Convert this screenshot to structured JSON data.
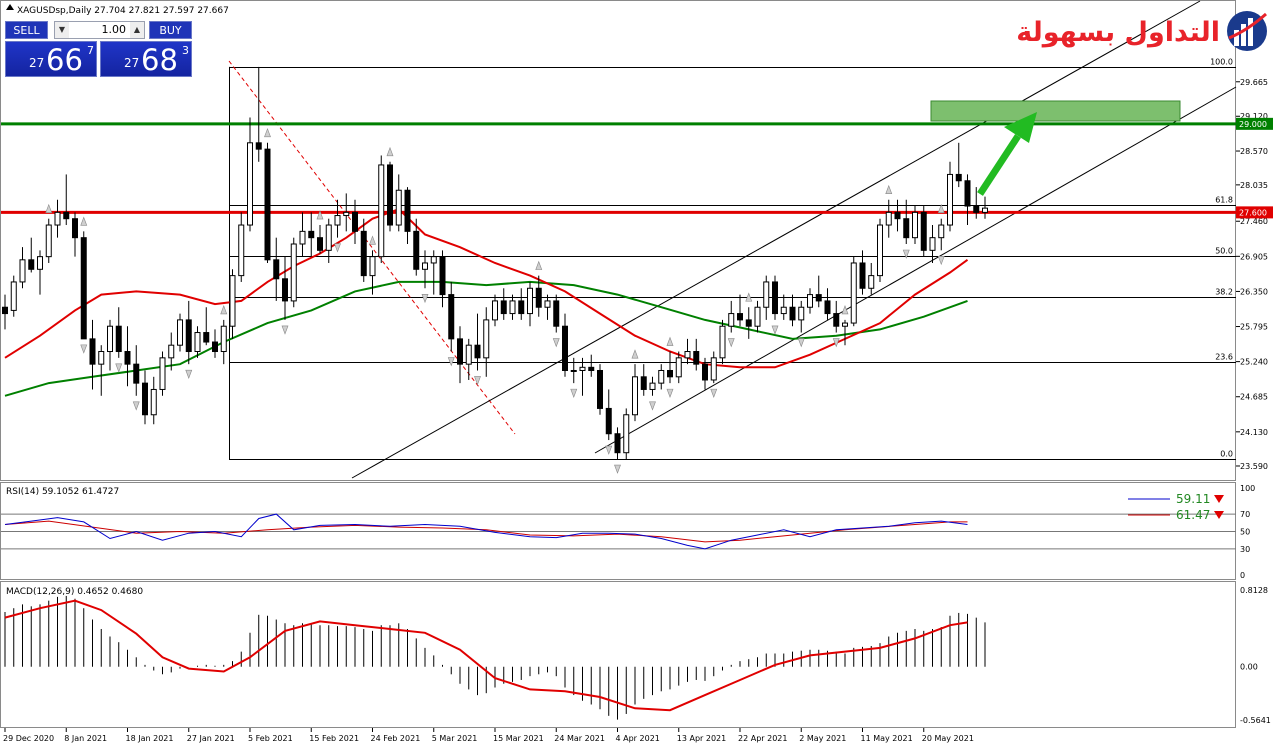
{
  "header": {
    "symbol_info": "XAGUSDsp,Daily  27.704 27.821 27.597 27.667"
  },
  "trade_panel": {
    "sell_label": "SELL",
    "buy_label": "BUY",
    "lot_value": "1.00",
    "sell_prefix": "27",
    "sell_big": "66",
    "sell_sup": "7",
    "buy_prefix": "27",
    "buy_big": "68",
    "buy_sup": "3"
  },
  "logo": {
    "text": "التداول بسهولة"
  },
  "main_axis": {
    "ticks": [
      "29.665",
      "29.120",
      "28.570",
      "28.035",
      "27.460",
      "26.905",
      "26.350",
      "25.795",
      "25.240",
      "24.685",
      "24.130",
      "23.590"
    ],
    "price_labels": [
      {
        "text": "29.000",
        "price": 29.0,
        "color": "#008000"
      },
      {
        "text": "27.600",
        "price": 27.6,
        "color": "#e00000"
      }
    ]
  },
  "fibonacci": {
    "levels": [
      {
        "label": "100.0",
        "price": 29.9
      },
      {
        "label": "61.8",
        "price": 27.72
      },
      {
        "label": "50.0",
        "price": 26.91
      },
      {
        "label": "38.2",
        "price": 26.26
      },
      {
        "label": "23.6",
        "price": 25.24
      },
      {
        "label": "0.0",
        "price": 23.7
      }
    ]
  },
  "horizontal_lines": [
    {
      "name": "resistance",
      "price": 29.0,
      "color": "#008000"
    },
    {
      "name": "support",
      "price": 27.6,
      "color": "#e00000"
    }
  ],
  "colors": {
    "bull_candle": "#ffffff",
    "bear_candle": "#000000",
    "ma_fast": "#e00000",
    "ma_slow": "#008000",
    "rsi_main": "#0000cc",
    "rsi_signal": "#cc0000",
    "macd_signal": "#e00000",
    "target_box": "#7dbf6e",
    "arrow": "#22bb22"
  },
  "rsi_panel": {
    "label": "RSI(14) 59.1052 61.4727",
    "ticks": [
      "100",
      "70",
      "50",
      "30",
      "0"
    ],
    "legend": [
      {
        "value": "59.11",
        "color": "#0000cc"
      },
      {
        "value": "61.47",
        "color": "#cc0000"
      }
    ]
  },
  "macd_panel": {
    "label": "MACD(12,26,9) 0.4652 0.4680",
    "ticks": [
      "0.8128",
      "0.00",
      "-0.5641"
    ]
  },
  "time_axis": {
    "labels": [
      "29 Dec 2020",
      "8 Jan 2021",
      "18 Jan 2021",
      "27 Jan 2021",
      "5 Feb 2021",
      "15 Feb 2021",
      "24 Feb 2021",
      "5 Mar 2021",
      "15 Mar 2021",
      "24 Mar 2021",
      "4 Apr 2021",
      "13 Apr 2021",
      "22 Apr 2021",
      "2 May 2021",
      "11 May 2021",
      "20 May 2021"
    ]
  },
  "chart_data": {
    "type": "candlestick",
    "symbol": "XAGUSDsp",
    "timeframe": "Daily",
    "ylim": [
      23.4,
      30.8
    ],
    "ohlc": [
      [
        26.1,
        26.3,
        25.75,
        26.0
      ],
      [
        26.05,
        26.6,
        25.95,
        26.5
      ],
      [
        26.5,
        27.05,
        26.4,
        26.85
      ],
      [
        26.85,
        27.2,
        26.65,
        26.7
      ],
      [
        26.7,
        27.0,
        26.3,
        26.9
      ],
      [
        26.9,
        27.5,
        26.8,
        27.4
      ],
      [
        27.4,
        27.8,
        27.2,
        27.6
      ],
      [
        27.6,
        28.2,
        27.4,
        27.5
      ],
      [
        27.5,
        27.6,
        26.9,
        27.2
      ],
      [
        27.2,
        27.3,
        25.6,
        25.6
      ],
      [
        25.6,
        25.9,
        24.8,
        25.2
      ],
      [
        25.2,
        25.5,
        24.7,
        25.4
      ],
      [
        25.4,
        25.9,
        25.1,
        25.8
      ],
      [
        25.8,
        26.1,
        25.3,
        25.4
      ],
      [
        25.4,
        25.8,
        24.85,
        25.2
      ],
      [
        25.2,
        25.5,
        24.7,
        24.9
      ],
      [
        24.9,
        25.1,
        24.25,
        24.4
      ],
      [
        24.4,
        25.0,
        24.25,
        24.8
      ],
      [
        24.8,
        25.4,
        24.7,
        25.3
      ],
      [
        25.3,
        25.7,
        25.1,
        25.5
      ],
      [
        25.5,
        26.0,
        25.4,
        25.9
      ],
      [
        25.9,
        26.2,
        25.2,
        25.4
      ],
      [
        25.4,
        25.8,
        25.3,
        25.7
      ],
      [
        25.7,
        26.1,
        25.5,
        25.55
      ],
      [
        25.55,
        25.75,
        25.3,
        25.4
      ],
      [
        25.4,
        25.9,
        25.2,
        25.8
      ],
      [
        25.8,
        26.7,
        25.6,
        26.6
      ],
      [
        26.6,
        27.6,
        26.5,
        27.4
      ],
      [
        27.4,
        29.1,
        27.3,
        28.7
      ],
      [
        28.7,
        29.9,
        28.4,
        28.6
      ],
      [
        28.6,
        28.7,
        26.8,
        26.85
      ],
      [
        26.85,
        27.2,
        26.2,
        26.55
      ],
      [
        26.55,
        26.9,
        25.9,
        26.2
      ],
      [
        26.2,
        27.2,
        26.1,
        27.1
      ],
      [
        27.1,
        27.6,
        26.9,
        27.3
      ],
      [
        27.3,
        27.6,
        26.9,
        27.2
      ],
      [
        27.2,
        27.4,
        26.95,
        27.0
      ],
      [
        27.0,
        27.5,
        26.8,
        27.4
      ],
      [
        27.4,
        27.8,
        27.2,
        27.55
      ],
      [
        27.55,
        27.9,
        27.3,
        27.6
      ],
      [
        27.6,
        27.8,
        27.1,
        27.3
      ],
      [
        27.3,
        27.5,
        26.5,
        26.6
      ],
      [
        26.6,
        27.0,
        26.3,
        26.9
      ],
      [
        26.9,
        28.5,
        26.8,
        28.35
      ],
      [
        28.35,
        28.4,
        27.3,
        27.4
      ],
      [
        27.4,
        28.2,
        27.3,
        27.95
      ],
      [
        27.95,
        28.0,
        27.1,
        27.3
      ],
      [
        27.3,
        27.5,
        26.6,
        26.7
      ],
      [
        26.7,
        27.0,
        26.4,
        26.8
      ],
      [
        26.8,
        27.0,
        26.3,
        26.9
      ],
      [
        26.9,
        27.0,
        26.1,
        26.3
      ],
      [
        26.3,
        26.5,
        25.4,
        25.6
      ],
      [
        25.6,
        25.8,
        24.9,
        25.2
      ],
      [
        25.2,
        25.6,
        24.95,
        25.5
      ],
      [
        25.5,
        26.0,
        25.1,
        25.3
      ],
      [
        25.3,
        26.1,
        25.0,
        25.9
      ],
      [
        25.9,
        26.3,
        25.8,
        26.2
      ],
      [
        26.2,
        26.4,
        25.9,
        26.0
      ],
      [
        26.0,
        26.3,
        25.9,
        26.2
      ],
      [
        26.2,
        26.4,
        25.9,
        26.0
      ],
      [
        26.0,
        26.5,
        25.8,
        26.4
      ],
      [
        26.4,
        26.6,
        25.95,
        26.1
      ],
      [
        26.1,
        26.3,
        25.9,
        26.2
      ],
      [
        26.2,
        26.3,
        25.7,
        25.8
      ],
      [
        25.8,
        26.0,
        25.0,
        25.1
      ],
      [
        25.1,
        25.3,
        24.9,
        25.1
      ],
      [
        25.1,
        25.3,
        24.7,
        25.15
      ],
      [
        25.15,
        25.35,
        25.0,
        25.1
      ],
      [
        25.1,
        25.2,
        24.4,
        24.5
      ],
      [
        24.5,
        24.8,
        24.0,
        24.1
      ],
      [
        24.1,
        24.2,
        23.7,
        23.8
      ],
      [
        23.8,
        24.5,
        23.7,
        24.4
      ],
      [
        24.4,
        25.2,
        24.3,
        25.0
      ],
      [
        25.0,
        25.2,
        24.7,
        24.8
      ],
      [
        24.8,
        25.0,
        24.7,
        24.9
      ],
      [
        24.9,
        25.2,
        24.8,
        25.1
      ],
      [
        25.1,
        25.4,
        24.9,
        25.0
      ],
      [
        25.0,
        25.4,
        24.9,
        25.3
      ],
      [
        25.3,
        25.6,
        25.2,
        25.4
      ],
      [
        25.4,
        25.6,
        25.1,
        25.2
      ],
      [
        25.2,
        25.3,
        24.8,
        24.95
      ],
      [
        24.95,
        25.4,
        24.9,
        25.3
      ],
      [
        25.3,
        25.9,
        25.2,
        25.8
      ],
      [
        25.8,
        26.2,
        25.7,
        26.0
      ],
      [
        26.0,
        26.3,
        25.8,
        25.9
      ],
      [
        25.9,
        26.1,
        25.6,
        25.8
      ],
      [
        25.8,
        26.2,
        25.7,
        26.1
      ],
      [
        26.1,
        26.6,
        25.9,
        26.5
      ],
      [
        26.5,
        26.6,
        25.9,
        26.0
      ],
      [
        26.0,
        26.3,
        25.9,
        26.1
      ],
      [
        26.1,
        26.3,
        25.8,
        25.9
      ],
      [
        25.9,
        26.2,
        25.7,
        26.1
      ],
      [
        26.1,
        26.4,
        26.0,
        26.3
      ],
      [
        26.3,
        26.6,
        26.1,
        26.2
      ],
      [
        26.2,
        26.4,
        25.9,
        26.0
      ],
      [
        26.0,
        26.2,
        25.7,
        25.8
      ],
      [
        25.8,
        25.9,
        25.5,
        25.85
      ],
      [
        25.85,
        26.9,
        25.8,
        26.8
      ],
      [
        26.8,
        27.0,
        26.3,
        26.4
      ],
      [
        26.4,
        26.8,
        26.3,
        26.6
      ],
      [
        26.6,
        27.5,
        26.5,
        27.4
      ],
      [
        27.4,
        27.8,
        27.2,
        27.6
      ],
      [
        27.6,
        27.8,
        27.3,
        27.5
      ],
      [
        27.5,
        27.8,
        27.1,
        27.2
      ],
      [
        27.2,
        27.7,
        27.1,
        27.6
      ],
      [
        27.6,
        27.7,
        26.9,
        27.0
      ],
      [
        27.0,
        27.4,
        26.8,
        27.2
      ],
      [
        27.2,
        27.5,
        27.0,
        27.4
      ],
      [
        27.4,
        28.4,
        27.3,
        28.2
      ],
      [
        28.2,
        28.7,
        28.0,
        28.1
      ],
      [
        28.1,
        28.2,
        27.4,
        27.7
      ],
      [
        27.7,
        28.0,
        27.5,
        27.6
      ],
      [
        27.6,
        27.85,
        27.5,
        27.667
      ]
    ],
    "ma_fast": [
      [
        0,
        25.3
      ],
      [
        4,
        25.65
      ],
      [
        8,
        26.05
      ],
      [
        11,
        26.3
      ],
      [
        15,
        26.35
      ],
      [
        20,
        26.3
      ],
      [
        24,
        26.15
      ],
      [
        27,
        26.2
      ],
      [
        30,
        26.5
      ],
      [
        33,
        26.75
      ],
      [
        36,
        26.95
      ],
      [
        39,
        27.2
      ],
      [
        42,
        27.5
      ],
      [
        45,
        27.65
      ],
      [
        48,
        27.25
      ],
      [
        52,
        27.05
      ],
      [
        56,
        26.8
      ],
      [
        60,
        26.6
      ],
      [
        64,
        26.35
      ],
      [
        68,
        26.0
      ],
      [
        72,
        25.65
      ],
      [
        76,
        25.4
      ],
      [
        80,
        25.2
      ],
      [
        84,
        25.15
      ],
      [
        88,
        25.15
      ],
      [
        92,
        25.35
      ],
      [
        96,
        25.6
      ],
      [
        100,
        25.85
      ],
      [
        104,
        26.3
      ],
      [
        108,
        26.65
      ],
      [
        110,
        26.85
      ]
    ],
    "ma_slow": [
      [
        0,
        24.7
      ],
      [
        5,
        24.9
      ],
      [
        10,
        25.0
      ],
      [
        15,
        25.1
      ],
      [
        20,
        25.2
      ],
      [
        25,
        25.55
      ],
      [
        30,
        25.85
      ],
      [
        35,
        26.05
      ],
      [
        40,
        26.35
      ],
      [
        45,
        26.5
      ],
      [
        50,
        26.5
      ],
      [
        55,
        26.45
      ],
      [
        60,
        26.5
      ],
      [
        65,
        26.45
      ],
      [
        70,
        26.3
      ],
      [
        75,
        26.1
      ],
      [
        80,
        25.9
      ],
      [
        85,
        25.75
      ],
      [
        90,
        25.6
      ],
      [
        95,
        25.65
      ],
      [
        100,
        25.75
      ],
      [
        105,
        25.95
      ],
      [
        110,
        26.2
      ]
    ],
    "rsi_main": [
      [
        0,
        58
      ],
      [
        3,
        62
      ],
      [
        6,
        66
      ],
      [
        9,
        61
      ],
      [
        12,
        42
      ],
      [
        15,
        50
      ],
      [
        18,
        40
      ],
      [
        21,
        48
      ],
      [
        24,
        50
      ],
      [
        27,
        44
      ],
      [
        29,
        65
      ],
      [
        31,
        70
      ],
      [
        33,
        52
      ],
      [
        36,
        57
      ],
      [
        40,
        58
      ],
      [
        44,
        56
      ],
      [
        48,
        58
      ],
      [
        52,
        56
      ],
      [
        56,
        49
      ],
      [
        60,
        44
      ],
      [
        63,
        43
      ],
      [
        66,
        48
      ],
      [
        69,
        48
      ],
      [
        72,
        47
      ],
      [
        75,
        42
      ],
      [
        78,
        34
      ],
      [
        80,
        30
      ],
      [
        83,
        40
      ],
      [
        86,
        46
      ],
      [
        89,
        52
      ],
      [
        92,
        44
      ],
      [
        95,
        52
      ],
      [
        98,
        54
      ],
      [
        101,
        56
      ],
      [
        104,
        60
      ],
      [
        107,
        62
      ],
      [
        110,
        58
      ]
    ],
    "rsi_signal": [
      [
        0,
        58
      ],
      [
        5,
        62
      ],
      [
        10,
        55
      ],
      [
        15,
        48
      ],
      [
        20,
        50
      ],
      [
        25,
        48
      ],
      [
        30,
        52
      ],
      [
        35,
        55
      ],
      [
        40,
        57
      ],
      [
        45,
        55
      ],
      [
        50,
        54
      ],
      [
        55,
        52
      ],
      [
        60,
        46
      ],
      [
        65,
        45
      ],
      [
        70,
        47
      ],
      [
        75,
        44
      ],
      [
        80,
        38
      ],
      [
        84,
        40
      ],
      [
        88,
        44
      ],
      [
        92,
        48
      ],
      [
        96,
        52
      ],
      [
        100,
        55
      ],
      [
        104,
        58
      ],
      [
        108,
        61
      ],
      [
        110,
        61
      ]
    ],
    "macd_hist": [
      0.58,
      0.62,
      0.66,
      0.64,
      0.66,
      0.7,
      0.74,
      0.75,
      0.72,
      0.62,
      0.5,
      0.4,
      0.32,
      0.26,
      0.18,
      0.1,
      0.02,
      -0.04,
      -0.08,
      -0.06,
      -0.02,
      0.0,
      0.01,
      0.02,
      0.01,
      0.02,
      0.06,
      0.16,
      0.36,
      0.55,
      0.54,
      0.5,
      0.46,
      0.44,
      0.46,
      0.45,
      0.44,
      0.44,
      0.43,
      0.43,
      0.42,
      0.4,
      0.38,
      0.44,
      0.44,
      0.46,
      0.4,
      0.3,
      0.2,
      0.12,
      0.02,
      -0.08,
      -0.18,
      -0.24,
      -0.3,
      -0.28,
      -0.22,
      -0.18,
      -0.16,
      -0.14,
      -0.1,
      -0.08,
      -0.06,
      -0.1,
      -0.22,
      -0.3,
      -0.36,
      -0.4,
      -0.45,
      -0.52,
      -0.56,
      -0.5,
      -0.4,
      -0.34,
      -0.3,
      -0.26,
      -0.24,
      -0.2,
      -0.16,
      -0.14,
      -0.15,
      -0.1,
      -0.04,
      0.02,
      0.06,
      0.08,
      0.1,
      0.14,
      0.14,
      0.14,
      0.16,
      0.17,
      0.18,
      0.18,
      0.17,
      0.16,
      0.14,
      0.2,
      0.21,
      0.22,
      0.25,
      0.32,
      0.36,
      0.38,
      0.4,
      0.38,
      0.4,
      0.42,
      0.54,
      0.57,
      0.56,
      0.52,
      0.47
    ],
    "macd_signal": [
      [
        0,
        0.52
      ],
      [
        4,
        0.62
      ],
      [
        8,
        0.7
      ],
      [
        11,
        0.6
      ],
      [
        15,
        0.35
      ],
      [
        18,
        0.1
      ],
      [
        21,
        -0.02
      ],
      [
        25,
        -0.05
      ],
      [
        28,
        0.1
      ],
      [
        32,
        0.38
      ],
      [
        36,
        0.48
      ],
      [
        40,
        0.44
      ],
      [
        44,
        0.4
      ],
      [
        48,
        0.36
      ],
      [
        52,
        0.18
      ],
      [
        56,
        -0.12
      ],
      [
        60,
        -0.24
      ],
      [
        64,
        -0.26
      ],
      [
        68,
        -0.32
      ],
      [
        72,
        -0.44
      ],
      [
        76,
        -0.46
      ],
      [
        80,
        -0.3
      ],
      [
        84,
        -0.14
      ],
      [
        88,
        0.02
      ],
      [
        92,
        0.12
      ],
      [
        96,
        0.16
      ],
      [
        100,
        0.2
      ],
      [
        104,
        0.3
      ],
      [
        108,
        0.44
      ],
      [
        110,
        0.47
      ]
    ]
  }
}
